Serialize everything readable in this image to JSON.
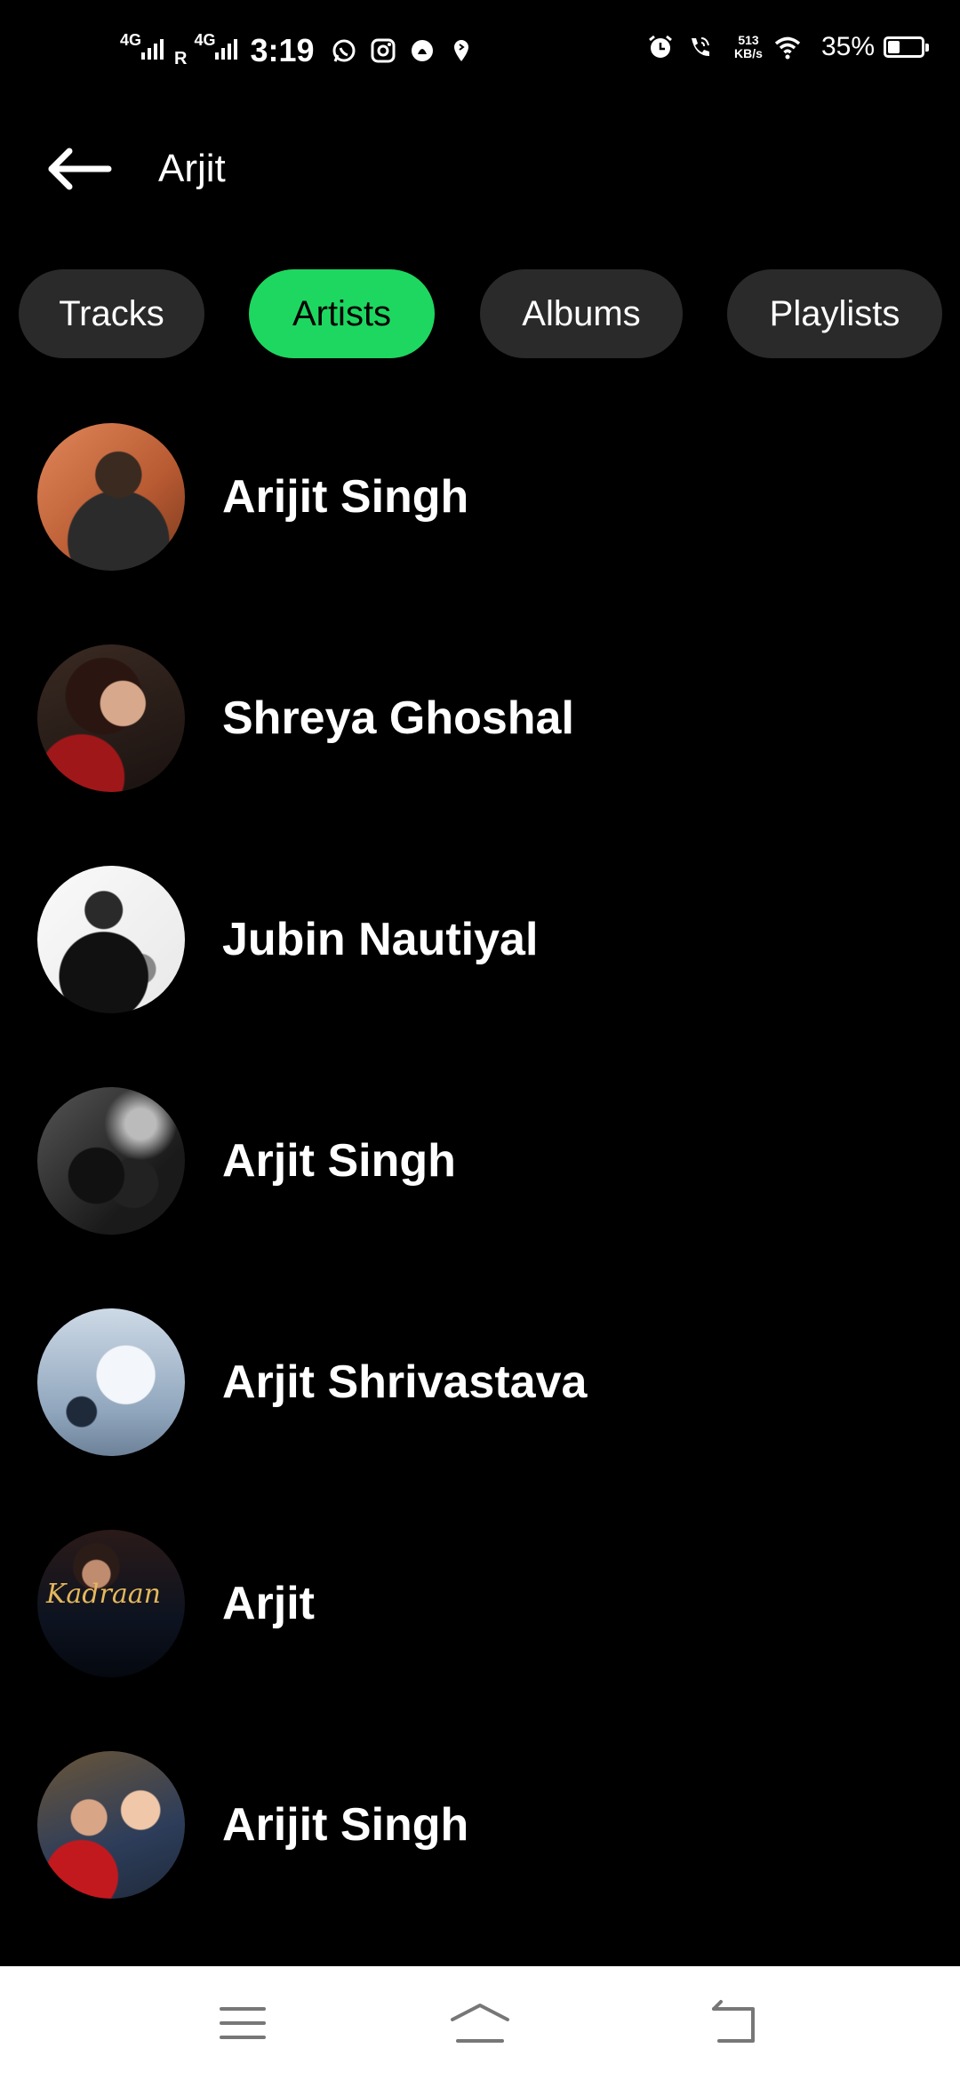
{
  "status_bar": {
    "network_1": "4G",
    "network_2": "4G",
    "roaming": "R",
    "time": "3:19",
    "net_speed_value": "513",
    "net_speed_unit": "KB/s",
    "battery_percent": "35%",
    "battery_level": 0.35,
    "icons": [
      "whatsapp-icon",
      "instagram-icon",
      "snapchat-icon",
      "app-notification-icon",
      "alarm-icon",
      "wifi-calling-icon",
      "wifi-icon"
    ]
  },
  "header": {
    "back_icon": "back-arrow-icon",
    "title": "Arjit"
  },
  "tabs": [
    {
      "label": "Tracks",
      "active": false
    },
    {
      "label": "Artists",
      "active": true
    },
    {
      "label": "Albums",
      "active": false
    },
    {
      "label": "Playlists",
      "active": false
    }
  ],
  "accent_color": "#1ed760",
  "artists": [
    {
      "name": "Arijit Singh"
    },
    {
      "name": "Shreya Ghoshal"
    },
    {
      "name": "Jubin Nautiyal"
    },
    {
      "name": "Arjit Singh"
    },
    {
      "name": "Arjit Shrivastava"
    },
    {
      "name": "Arjit",
      "cover_text": "Kadraan"
    },
    {
      "name": "Arijit Singh"
    }
  ],
  "nav_bar": {
    "icons": [
      "menu-icon",
      "home-icon",
      "back-icon"
    ]
  }
}
